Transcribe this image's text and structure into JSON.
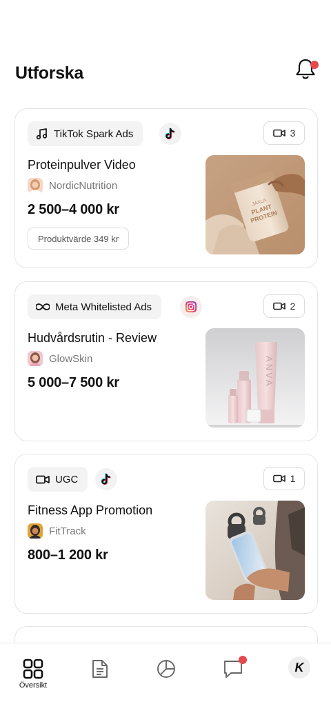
{
  "header": {
    "title": "Utforska"
  },
  "campaigns": [
    {
      "type_label": "TikTok Spark Ads",
      "type_icon": "music-note-icon",
      "platform": "tiktok",
      "video_count": "3",
      "title": "Proteinpulver Video",
      "brand": "NordicNutrition",
      "price": "2 500–4 000 kr",
      "product_value": "Produktvärde 349 kr",
      "thumb_text": [
        "JAXLA",
        "PLANT",
        "PROTEIN"
      ]
    },
    {
      "type_label": "Meta Whitelisted Ads",
      "type_icon": "infinity-icon",
      "platform": "instagram",
      "video_count": "2",
      "title": "Hudvårdsrutin - Review",
      "brand": "GlowSkin",
      "price": "5 000–7 500 kr",
      "thumb_text": [
        "ANVA"
      ]
    },
    {
      "type_label": "UGC",
      "type_icon": "video-camera-icon",
      "platform": "tiktok",
      "video_count": "1",
      "title": "Fitness App Promotion",
      "brand": "FitTrack",
      "price": "800–1 200 kr"
    }
  ],
  "nav": {
    "items": [
      {
        "id": "overview",
        "label": "Översikt",
        "icon": "grid-icon",
        "active": true
      },
      {
        "id": "documents",
        "label": "",
        "icon": "document-icon"
      },
      {
        "id": "stats",
        "label": "",
        "icon": "pie-chart-icon"
      },
      {
        "id": "messages",
        "label": "",
        "icon": "chat-icon",
        "badge": true
      },
      {
        "id": "profile",
        "label": "",
        "icon": "profile-avatar",
        "avatar_letter": "K"
      }
    ]
  },
  "colors": {
    "badge": "#e5484d",
    "text": "#111111",
    "muted": "#777777",
    "border": "#e4e4e4"
  }
}
